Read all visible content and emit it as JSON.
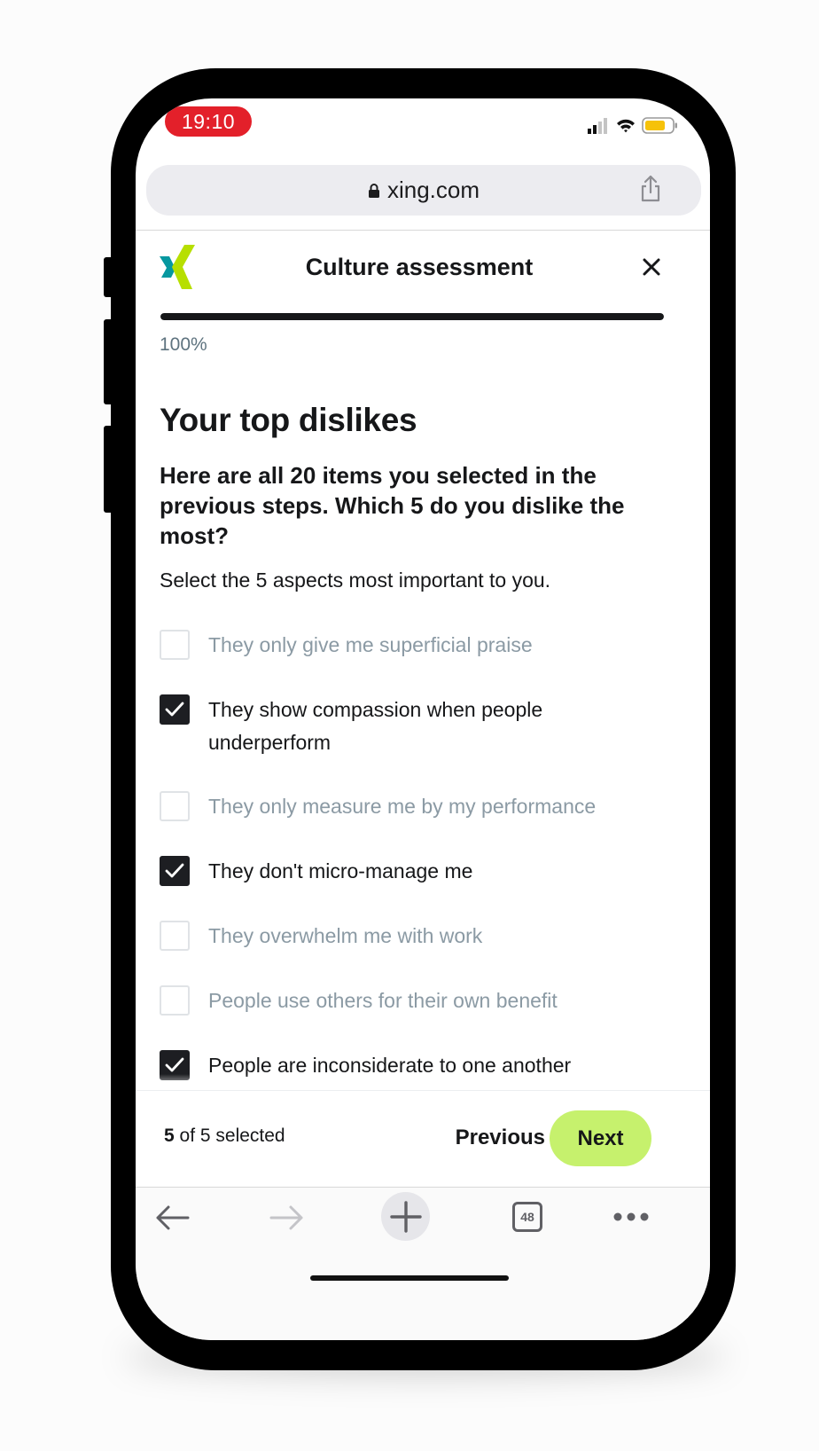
{
  "status_bar": {
    "time": "19:10"
  },
  "browser": {
    "url": "xing.com",
    "tab_count": "48"
  },
  "header": {
    "title": "Culture assessment"
  },
  "progress": {
    "value": 1.0,
    "label": "100%"
  },
  "content": {
    "heading": "Your top dislikes",
    "subheading": "Here are all 20 items you selected in the previous steps. Which 5 do you dislike the most?",
    "hint": "Select the 5 aspects most important to you.",
    "options": [
      {
        "label": "They only give me superficial praise",
        "checked": false
      },
      {
        "label": "They show compassion when people underperform",
        "checked": true
      },
      {
        "label": "They only measure me by my performance",
        "checked": false
      },
      {
        "label": "They don't micro-manage me",
        "checked": true
      },
      {
        "label": "They overwhelm me with work",
        "checked": false
      },
      {
        "label": "People use others for their own benefit",
        "checked": false
      },
      {
        "label": "People are inconsiderate to one another",
        "checked": true
      }
    ]
  },
  "footer": {
    "selected_count": "5",
    "selected_suffix": "of 5 selected",
    "previous_label": "Previous",
    "next_label": "Next"
  },
  "colors": {
    "accent": "#c6f16d",
    "time_pill": "#e3202a",
    "logo_teal": "#0698a0",
    "logo_green": "#b7df00",
    "text_primary": "#161719",
    "text_muted": "#8b9aa4"
  }
}
